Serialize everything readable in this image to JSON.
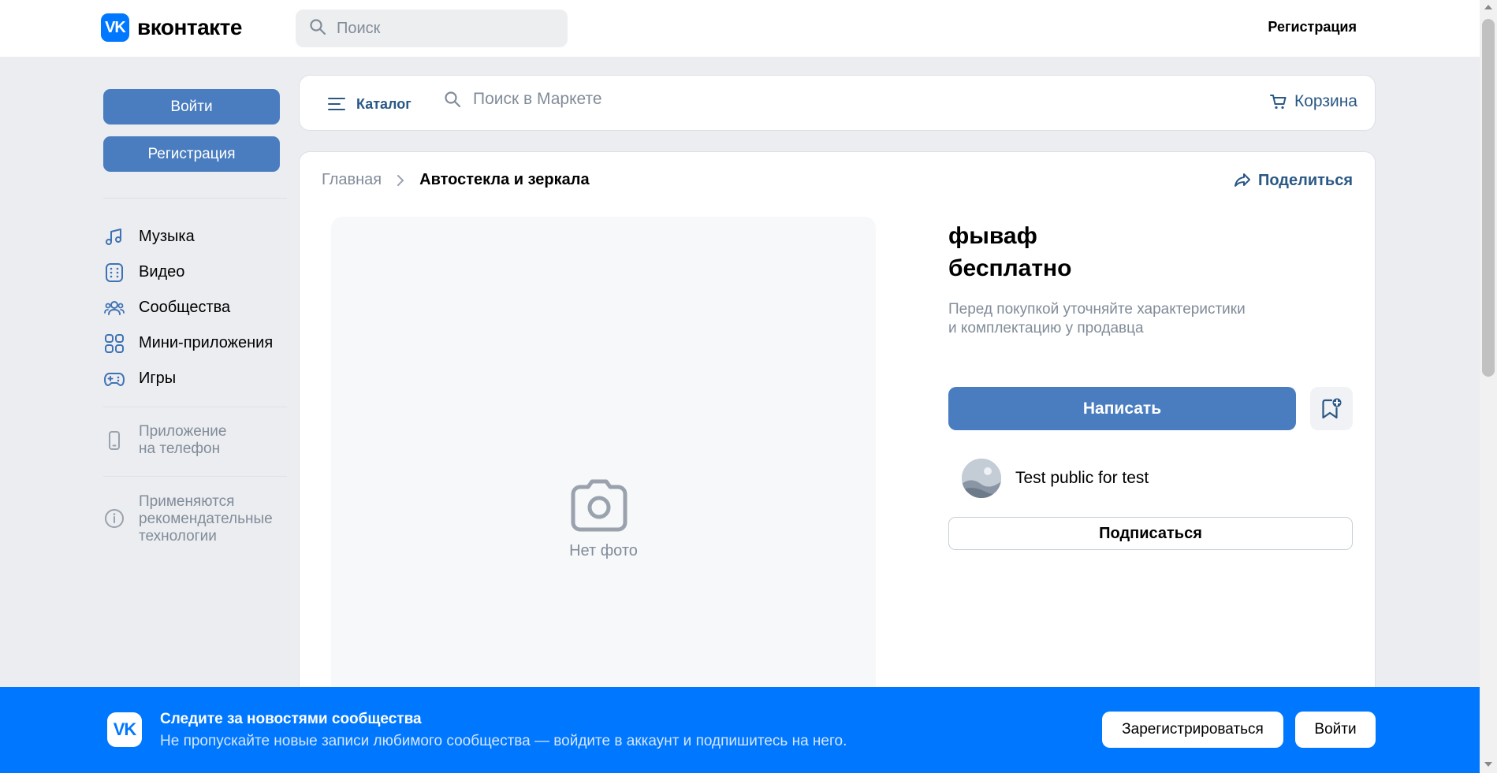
{
  "header": {
    "logo_glyph": "VK",
    "logo_text": "вконтакте",
    "search_placeholder": "Поиск",
    "register_label": "Регистрация"
  },
  "sidebar": {
    "login_label": "Войти",
    "register_label": "Регистрация",
    "items": [
      {
        "label": "Музыка",
        "icon": "music-icon"
      },
      {
        "label": "Видео",
        "icon": "video-icon"
      },
      {
        "label": "Сообщества",
        "icon": "communities-icon"
      },
      {
        "label": "Мини-приложения",
        "icon": "mini-apps-icon"
      },
      {
        "label": "Игры",
        "icon": "games-icon"
      }
    ],
    "phone_app_line1": "Приложение",
    "phone_app_line2": "на телефон",
    "recommend_line1": "Применяются",
    "recommend_line2": "рекомендательные",
    "recommend_line3": "технологии"
  },
  "market": {
    "catalog_label": "Каталог",
    "search_placeholder": "Поиск в Маркете",
    "cart_label": "Корзина"
  },
  "product": {
    "breadcrumb_home": "Главная",
    "breadcrumb_current": "Автостекла и зеркала",
    "share_label": "Поделиться",
    "no_photo_label": "Нет фото",
    "title": "фываф",
    "price": "бесплатно",
    "note_line1": "Перед покупкой уточняйте характеристики",
    "note_line2": "и комплектацию у продавца",
    "write_label": "Написать",
    "seller_name": "Test public for test",
    "subscribe_label": "Подписаться"
  },
  "banner": {
    "logo_glyph": "VK",
    "title": "Следите за новостями сообщества",
    "subtitle": "Не пропускайте новые записи любимого сообщества — войдите в аккаунт и подпишитесь на него.",
    "register_label": "Зарегистрироваться",
    "login_label": "Войти"
  },
  "colors": {
    "brand": "#0077ff",
    "button": "#4a7dbf",
    "link": "#2a5885",
    "secondary_text": "#818c99",
    "page_bg": "#ebedf0"
  }
}
